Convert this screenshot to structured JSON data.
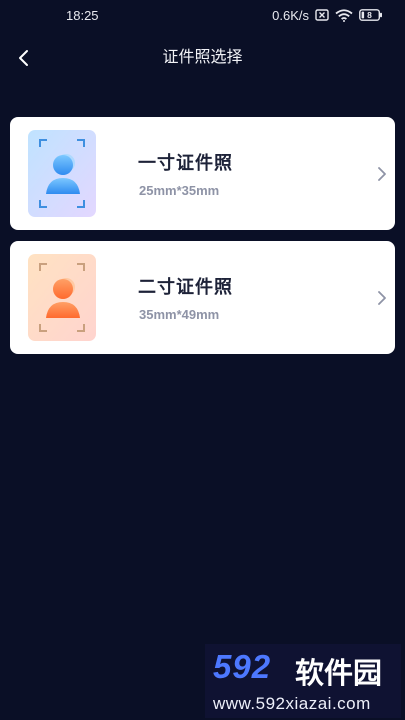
{
  "status_bar": {
    "time": "18:25",
    "network_speed": "0.6K/s",
    "sim_icon": "sim-off-icon",
    "wifi_icon": "wifi-icon",
    "battery_level": "8"
  },
  "nav": {
    "title": "证件照选择",
    "back_icon": "back-arrow-icon"
  },
  "options": [
    {
      "name": "一寸证件照",
      "size": "25mm*35mm",
      "thumb_color": "#4aa6ff"
    },
    {
      "name": "二寸证件照",
      "size": "35mm*49mm",
      "thumb_color": "#ff7a3d"
    }
  ],
  "watermark": {
    "logo": "592",
    "text": "软件园",
    "url": "www.592xiazai.com"
  },
  "colors": {
    "background": "#0a0f26",
    "card": "#ffffff",
    "title_text": "#1d2238",
    "subtitle_text": "#8e93a6"
  }
}
